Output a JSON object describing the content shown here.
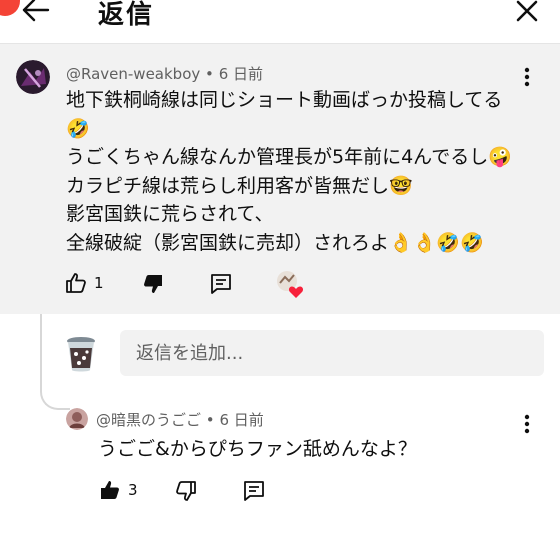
{
  "header": {
    "title": "返信",
    "back_icon": "arrow-left-icon",
    "close_icon": "close-icon"
  },
  "parent_comment": {
    "author": "@Raven-weakboy",
    "separator": "•",
    "time": "6 日前",
    "lines": [
      "地下鉄桐崎線は同じショート動画ばっか投稿してる",
      "🤣",
      "うごくちゃん線なんか管理長が5年前に4んでるし🤪",
      "カラピチ線は荒らし利用客が皆無だし🤓",
      "影宮国鉄に荒らされて、",
      "全線破綻（影宮国鉄に売却）されろよ👌👌🤣🤣"
    ],
    "likes": "1",
    "icons": [
      "thumbs-up-outline-icon",
      "thumbs-down-filled-icon",
      "comment-icon",
      "creator-heart-icon"
    ]
  },
  "reply_box": {
    "placeholder": "返信を追加..."
  },
  "reply": {
    "author": "@暗黒のうごご",
    "separator": "•",
    "time": "6 日前",
    "text": "うごご&からぴちファン舐めんなよ？",
    "likes": "3",
    "icons": [
      "thumbs-up-filled-icon",
      "thumbs-down-outline-icon",
      "comment-icon"
    ]
  },
  "colors": {
    "background": "#ffffff",
    "parent_background": "#f2f2f2",
    "meta_text": "#606060",
    "heart": "#f7213b",
    "accent_red": "#f44336"
  }
}
